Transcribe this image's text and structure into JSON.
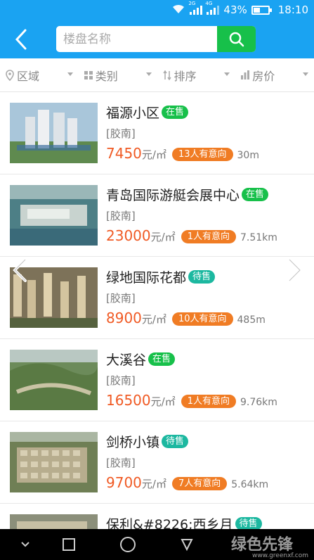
{
  "status_bar": {
    "battery": "43%",
    "time": "18:10",
    "network_1": "2G",
    "network_2": "4G"
  },
  "header": {
    "search_placeholder": "楼盘名称",
    "search_value": ""
  },
  "filters": [
    {
      "label": "区域",
      "icon": "location-pin-icon"
    },
    {
      "label": "类别",
      "icon": "grid-icon"
    },
    {
      "label": "排序",
      "icon": "sort-icon"
    },
    {
      "label": "房价",
      "icon": "bar-chart-icon"
    }
  ],
  "listings": [
    {
      "name": "福源小区",
      "status": "在售",
      "status_type": "onsale",
      "district": "[胶南]",
      "price": "7450",
      "unit": "元/㎡",
      "interest": "13人有意向",
      "distance": "30m"
    },
    {
      "name": "青岛国际游艇会展中心",
      "status": "在售",
      "status_type": "onsale",
      "district": "[胶南]",
      "price": "23000",
      "unit": "元/㎡",
      "interest": "1人有意向",
      "distance": "7.51km"
    },
    {
      "name": "绿地国际花都",
      "status": "待售",
      "status_type": "pending",
      "district": "[胶南]",
      "price": "8900",
      "unit": "元/㎡",
      "interest": "10人有意向",
      "distance": "485m"
    },
    {
      "name": "大溪谷",
      "status": "在售",
      "status_type": "onsale",
      "district": "[胶南]",
      "price": "16500",
      "unit": "元/㎡",
      "interest": "1人有意向",
      "distance": "9.76km"
    },
    {
      "name": "剑桥小镇",
      "status": "待售",
      "status_type": "pending",
      "district": "[胶南]",
      "price": "9700",
      "unit": "元/㎡",
      "interest": "7人有意向",
      "distance": "5.64km"
    },
    {
      "name": "保利&#8226;西乡月",
      "status": "待售",
      "status_type": "pending",
      "district": "",
      "price": "",
      "unit": "",
      "interest": "",
      "distance": ""
    }
  ],
  "watermark": {
    "text": "绿色先锋",
    "url": "www.greenxf.com"
  },
  "colors": {
    "primary": "#1aa3f2",
    "search_button": "#17c04a",
    "price": "#f05a24",
    "interest_badge": "#f07c24",
    "status_onsale": "#17c04a",
    "status_pending": "#1cb8a0"
  }
}
